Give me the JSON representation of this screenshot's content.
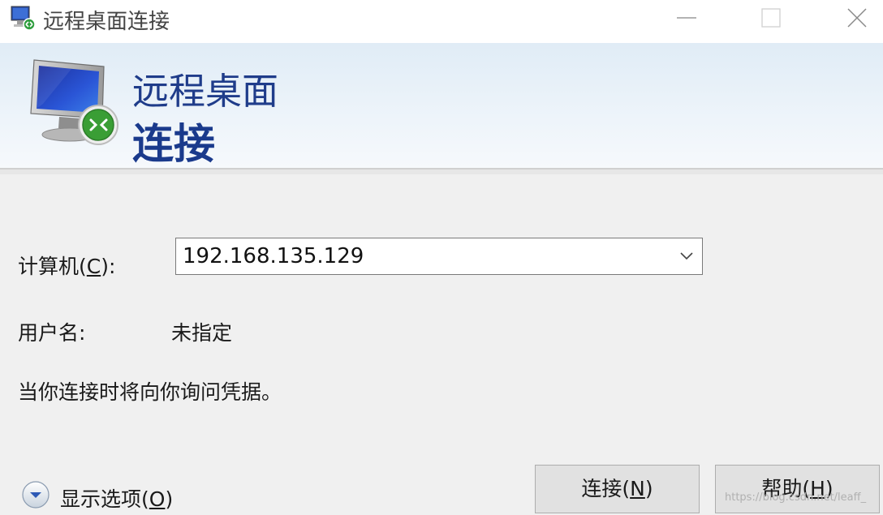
{
  "window": {
    "title": "远程桌面连接",
    "controls": [
      "minimize",
      "maximize",
      "close"
    ]
  },
  "banner": {
    "line1": "远程桌面",
    "line2": "连接"
  },
  "form": {
    "computer_label_pre": "计算机(",
    "computer_label_key": "C",
    "computer_label_post": "):",
    "computer_value": "192.168.135.129",
    "username_label": "用户名:",
    "username_value": "未指定",
    "credentials_note": "当你连接时将向你询问凭据。"
  },
  "footer": {
    "show_options_pre": "显示选项(",
    "show_options_key": "O",
    "show_options_post": ")",
    "connect_pre": "连接(",
    "connect_key": "N",
    "connect_post": ")",
    "help_pre": "帮助(",
    "help_key": "H",
    "help_post": ")"
  },
  "watermark": "https://blog.csdn.net/leaff_",
  "colors": {
    "banner_text": "#1f3c8a",
    "button_bg": "#e1e1e1",
    "window_bg": "#f0f0f0"
  },
  "icons": [
    "remote-desktop-icon",
    "monitor-icon",
    "dropdown-chevron-icon",
    "expand-options-icon"
  ]
}
